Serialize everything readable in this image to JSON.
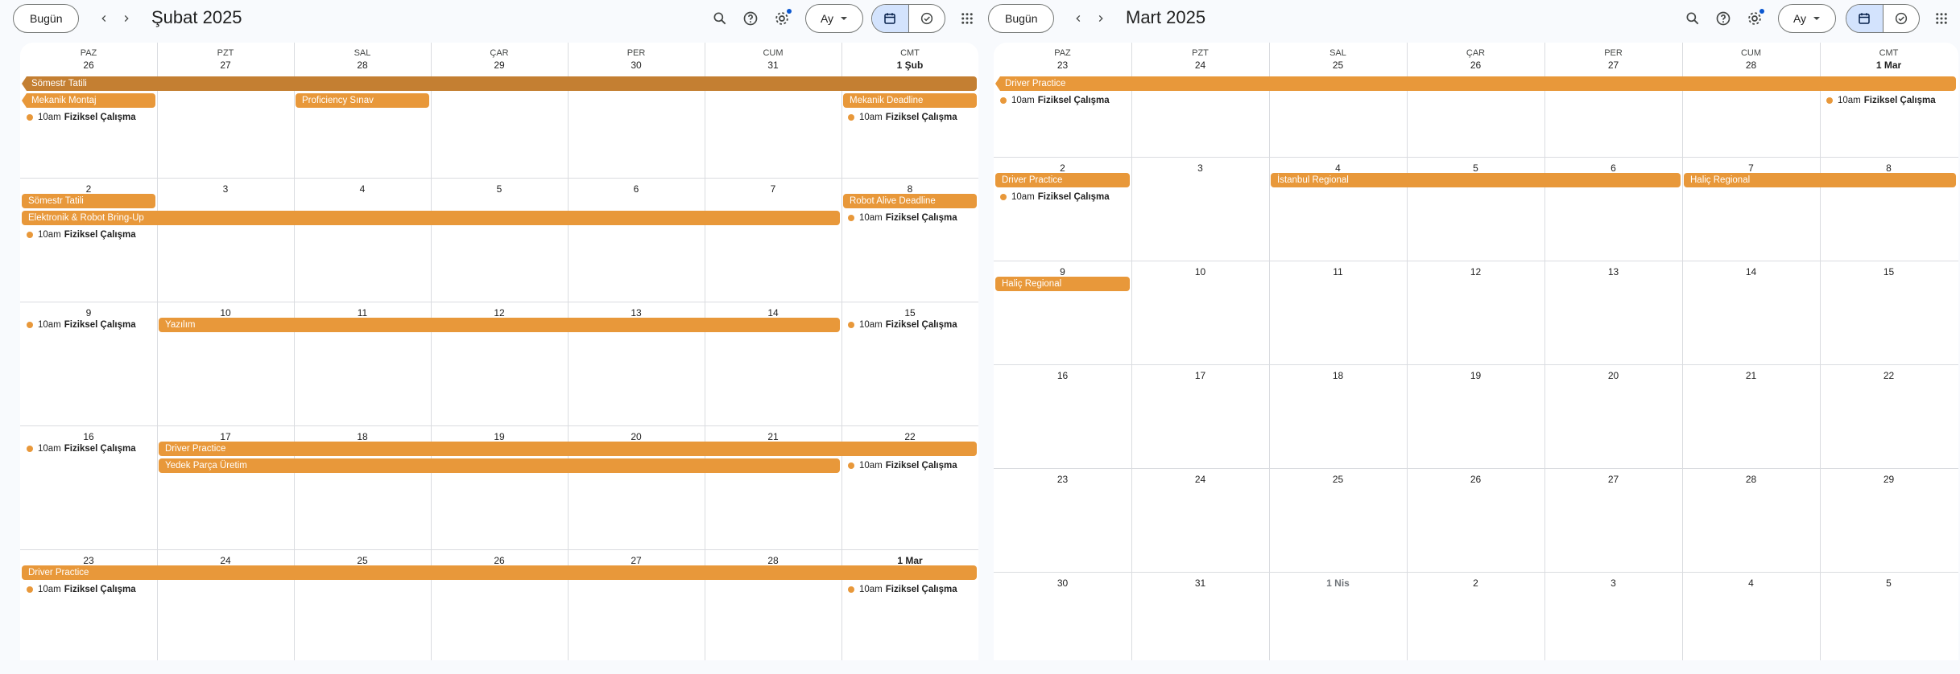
{
  "toolbar_common": {
    "today_label": "Bugün",
    "view_label": "Ay",
    "icons": [
      "chevron-left-icon",
      "chevron-right-icon",
      "search-icon",
      "help-icon",
      "settings-icon",
      "dropdown-arrow-icon",
      "calendar-icon",
      "tasks-icon",
      "apps-grid-icon"
    ],
    "accent": "#e8983a",
    "accent_dark": "#c47f32",
    "active_segment_bg": "#d3e3fd"
  },
  "weekdays": [
    "PAZ",
    "PZT",
    "SAL",
    "ÇAR",
    "PER",
    "CUM",
    "CMT"
  ],
  "left": {
    "month_title": "Şubat 2025",
    "weeks": [
      [
        "26",
        "27",
        "28",
        "29",
        "30",
        "31",
        "1 Şub"
      ],
      [
        "2",
        "3",
        "4",
        "5",
        "6",
        "7",
        "8"
      ],
      [
        "9",
        "10",
        "11",
        "12",
        "13",
        "14",
        "15"
      ],
      [
        "16",
        "17",
        "18",
        "19",
        "20",
        "21",
        "22"
      ],
      [
        "23",
        "24",
        "25",
        "26",
        "27",
        "28",
        "1 Mar"
      ]
    ],
    "bars": [
      {
        "title": "Sömestr Tatili",
        "week": 0,
        "start": 0,
        "end": 6,
        "row": 0,
        "style": "dark",
        "notch": true
      },
      {
        "title": "Mekanik Montaj",
        "week": 0,
        "start": 0,
        "end": 0,
        "row": 1,
        "style": "normal",
        "notch": true
      },
      {
        "title": "Proficiency Sınav",
        "week": 0,
        "start": 2,
        "end": 2,
        "row": 1,
        "style": "normal",
        "notch": false
      },
      {
        "title": "Mekanik Deadline",
        "week": 0,
        "start": 6,
        "end": 6,
        "row": 1,
        "style": "normal",
        "notch": false
      },
      {
        "title": "Sömestr Tatili",
        "week": 1,
        "start": 0,
        "end": 0,
        "row": 0,
        "style": "normal",
        "notch": false
      },
      {
        "title": "Robot Alive Deadline",
        "week": 1,
        "start": 6,
        "end": 6,
        "row": 0,
        "style": "normal",
        "notch": false
      },
      {
        "title": "Elektronik & Robot Bring-Up",
        "week": 1,
        "start": 0,
        "end": 5,
        "row": 1,
        "style": "normal",
        "notch": false
      },
      {
        "title": "Yazılım",
        "week": 2,
        "start": 1,
        "end": 5,
        "row": 0,
        "style": "normal",
        "notch": false
      },
      {
        "title": "Driver Practice",
        "week": 3,
        "start": 1,
        "end": 6,
        "row": 0,
        "style": "normal",
        "notch": false
      },
      {
        "title": "Yedek Parça Üretim",
        "week": 3,
        "start": 1,
        "end": 5,
        "row": 1,
        "style": "normal",
        "notch": false
      },
      {
        "title": "Driver Practice",
        "week": 4,
        "start": 0,
        "end": 6,
        "row": 0,
        "style": "normal",
        "notch": false
      }
    ],
    "timed": [
      {
        "time": "10am",
        "title": "Fiziksel Çalışma",
        "week": 0,
        "day": 0,
        "row": 2
      },
      {
        "time": "10am",
        "title": "Fiziksel Çalışma",
        "week": 0,
        "day": 6,
        "row": 2
      },
      {
        "time": "10am",
        "title": "Fiziksel Çalışma",
        "week": 1,
        "day": 0,
        "row": 2
      },
      {
        "time": "10am",
        "title": "Fiziksel Çalışma",
        "week": 1,
        "day": 6,
        "row": 1
      },
      {
        "time": "10am",
        "title": "Fiziksel Çalışma",
        "week": 2,
        "day": 0,
        "row": 0
      },
      {
        "time": "10am",
        "title": "Fiziksel Çalışma",
        "week": 2,
        "day": 6,
        "row": 0
      },
      {
        "time": "10am",
        "title": "Fiziksel Çalışma",
        "week": 3,
        "day": 0,
        "row": 0
      },
      {
        "time": "10am",
        "title": "Fiziksel Çalışma",
        "week": 3,
        "day": 6,
        "row": 1
      },
      {
        "time": "10am",
        "title": "Fiziksel Çalışma",
        "week": 4,
        "day": 0,
        "row": 1
      },
      {
        "time": "10am",
        "title": "Fiziksel Çalışma",
        "week": 4,
        "day": 6,
        "row": 1
      }
    ]
  },
  "right": {
    "month_title": "Mart 2025",
    "weeks": [
      [
        "23",
        "24",
        "25",
        "26",
        "27",
        "28",
        "1 Mar"
      ],
      [
        "2",
        "3",
        "4",
        "5",
        "6",
        "7",
        "8"
      ],
      [
        "9",
        "10",
        "11",
        "12",
        "13",
        "14",
        "15"
      ],
      [
        "16",
        "17",
        "18",
        "19",
        "20",
        "21",
        "22"
      ],
      [
        "23",
        "24",
        "25",
        "26",
        "27",
        "28",
        "29"
      ],
      [
        "30",
        "31",
        "1 Nis",
        "2",
        "3",
        "4",
        "5"
      ]
    ],
    "bars": [
      {
        "title": "Driver Practice",
        "week": 0,
        "start": 0,
        "end": 6,
        "row": 0,
        "style": "normal",
        "notch": true
      },
      {
        "title": "Driver Practice",
        "week": 1,
        "start": 0,
        "end": 0,
        "row": 0,
        "style": "normal",
        "notch": false
      },
      {
        "title": "İstanbul Regional",
        "week": 1,
        "start": 2,
        "end": 4,
        "row": 0,
        "style": "normal",
        "notch": false
      },
      {
        "title": "Haliç Regional",
        "week": 1,
        "start": 5,
        "end": 6,
        "row": 0,
        "style": "normal",
        "notch": false
      },
      {
        "title": "Haliç Regional",
        "week": 2,
        "start": 0,
        "end": 0,
        "row": 0,
        "style": "normal",
        "notch": false
      }
    ],
    "timed": [
      {
        "time": "10am",
        "title": "Fiziksel Çalışma",
        "week": 0,
        "day": 0,
        "row": 1
      },
      {
        "time": "10am",
        "title": "Fiziksel Çalışma",
        "week": 0,
        "day": 6,
        "row": 1
      },
      {
        "time": "10am",
        "title": "Fiziksel Çalışma",
        "week": 1,
        "day": 0,
        "row": 1
      }
    ]
  }
}
